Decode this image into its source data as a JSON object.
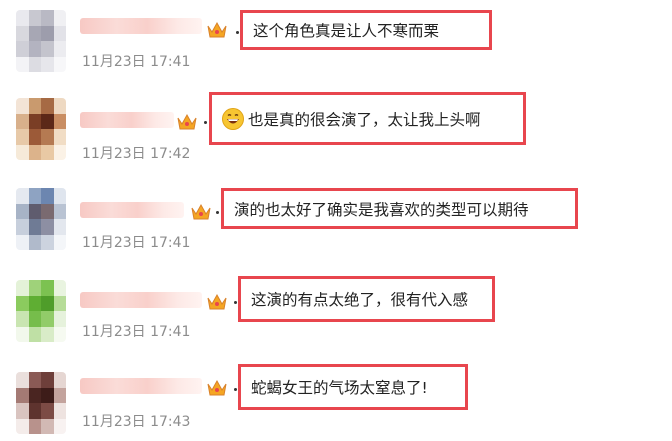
{
  "comments": [
    {
      "text": "这个角色真是让人不寒而栗",
      "time": "11月23日 17:41",
      "emoji": null,
      "avatar_colors": [
        "#e9e9ee",
        "#c8c8d0",
        "#b9b9c4",
        "#f0f0f3",
        "#d8d8de",
        "#a7a7b4",
        "#9d9dac",
        "#e2e2e8",
        "#cfcfd7",
        "#b3b3c0",
        "#c4c4cd",
        "#ececf0",
        "#f3f3f6",
        "#dcdce2",
        "#e6e6eb",
        "#f7f7f9"
      ]
    },
    {
      "text": "也是真的很会演了，太让我上头啊",
      "time": "11月23日 17:42",
      "emoji": "grinning-face-emoji",
      "avatar_colors": [
        "#f3e4d6",
        "#c99a6e",
        "#a66a44",
        "#eed9c2",
        "#d8b08b",
        "#7a3e25",
        "#5b2818",
        "#c98e63",
        "#e7c9a8",
        "#9c5a38",
        "#b57a52",
        "#f1ddc5",
        "#f6ead9",
        "#dcb38b",
        "#e9c9a4",
        "#fbf2e6"
      ]
    },
    {
      "text": "演的也太好了确实是我喜欢的类型可以期待",
      "time": "11月23日 17:41",
      "emoji": null,
      "avatar_colors": [
        "#e5e9f0",
        "#8ea3c2",
        "#6c86b0",
        "#dfe5ee",
        "#a7b3c6",
        "#5f5c6e",
        "#7a6a70",
        "#b9c3d3",
        "#c7cfdc",
        "#6f7b95",
        "#8d8fa3",
        "#e3e7ee",
        "#eef1f6",
        "#b0bacb",
        "#ccd3df",
        "#f4f6f9"
      ]
    },
    {
      "text": "这演的有点太绝了，很有代入感",
      "time": "11月23日 17:41",
      "emoji": null,
      "avatar_colors": [
        "#e4f2d8",
        "#9fd27a",
        "#7cc251",
        "#e9f4e0",
        "#8bcb5e",
        "#5fae33",
        "#4f9d2a",
        "#b6dc98",
        "#c9e5b1",
        "#76bd4b",
        "#92cc69",
        "#e6f2dc",
        "#f2f8ec",
        "#bfe0a5",
        "#d9ecc8",
        "#f6faf1"
      ]
    },
    {
      "text": "蛇蝎女王的气场太窒息了!",
      "time": "11月23日 17:43",
      "emoji": null,
      "avatar_colors": [
        "#eadfdc",
        "#8a5a55",
        "#6e3f3a",
        "#e5d6d2",
        "#a47a74",
        "#4a2521",
        "#3d1c19",
        "#c3a39d",
        "#d9c4c0",
        "#5e332e",
        "#7c4b45",
        "#eee3e0",
        "#f4ecea",
        "#b8928c",
        "#d2b9b4",
        "#f8f2f1"
      ]
    }
  ]
}
